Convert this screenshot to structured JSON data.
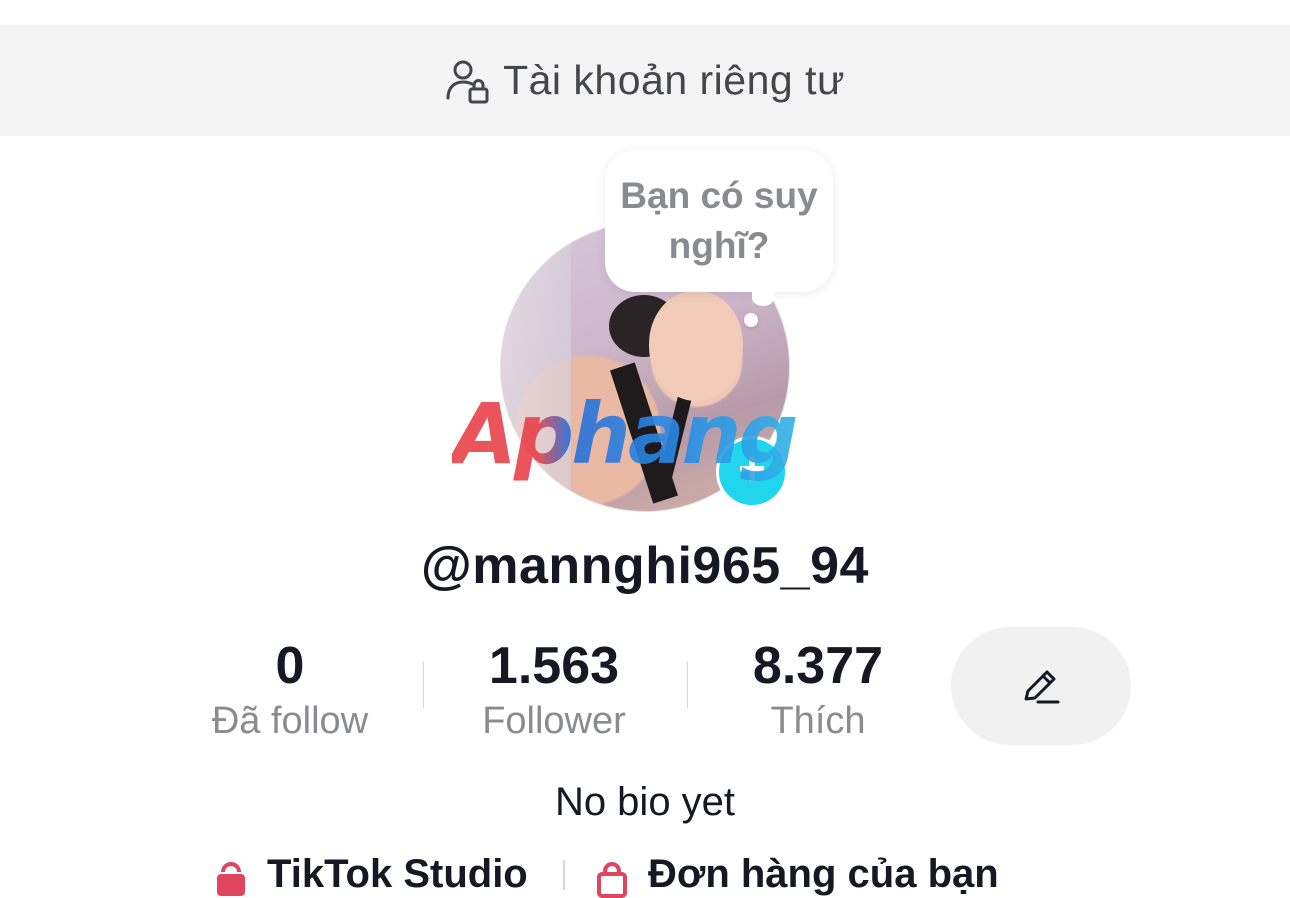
{
  "banner": {
    "icon": "private-account-icon",
    "text": "Tài khoản riêng tư"
  },
  "bubble": {
    "text": "Bạn có suy nghĩ?"
  },
  "avatar": {
    "add_icon": "+"
  },
  "watermark": {
    "text": "Aphang"
  },
  "profile": {
    "username": "@mannghi965_94",
    "bio": "No bio yet"
  },
  "stats": [
    {
      "value": "0",
      "label": "Đã follow"
    },
    {
      "value": "1.563",
      "label": "Follower"
    },
    {
      "value": "8.377",
      "label": "Thích"
    }
  ],
  "edit": {
    "icon": "edit-pencil-icon"
  },
  "links": [
    {
      "label": "TikTok Studio",
      "icon": "studio-icon"
    },
    {
      "label": "Đơn hàng của bạn",
      "icon": "shopping-bag-icon"
    }
  ],
  "colors": {
    "accent": "#20d5ec",
    "text": "#161823",
    "muted": "#8a8b91",
    "banner_bg": "#f4f4f4"
  }
}
